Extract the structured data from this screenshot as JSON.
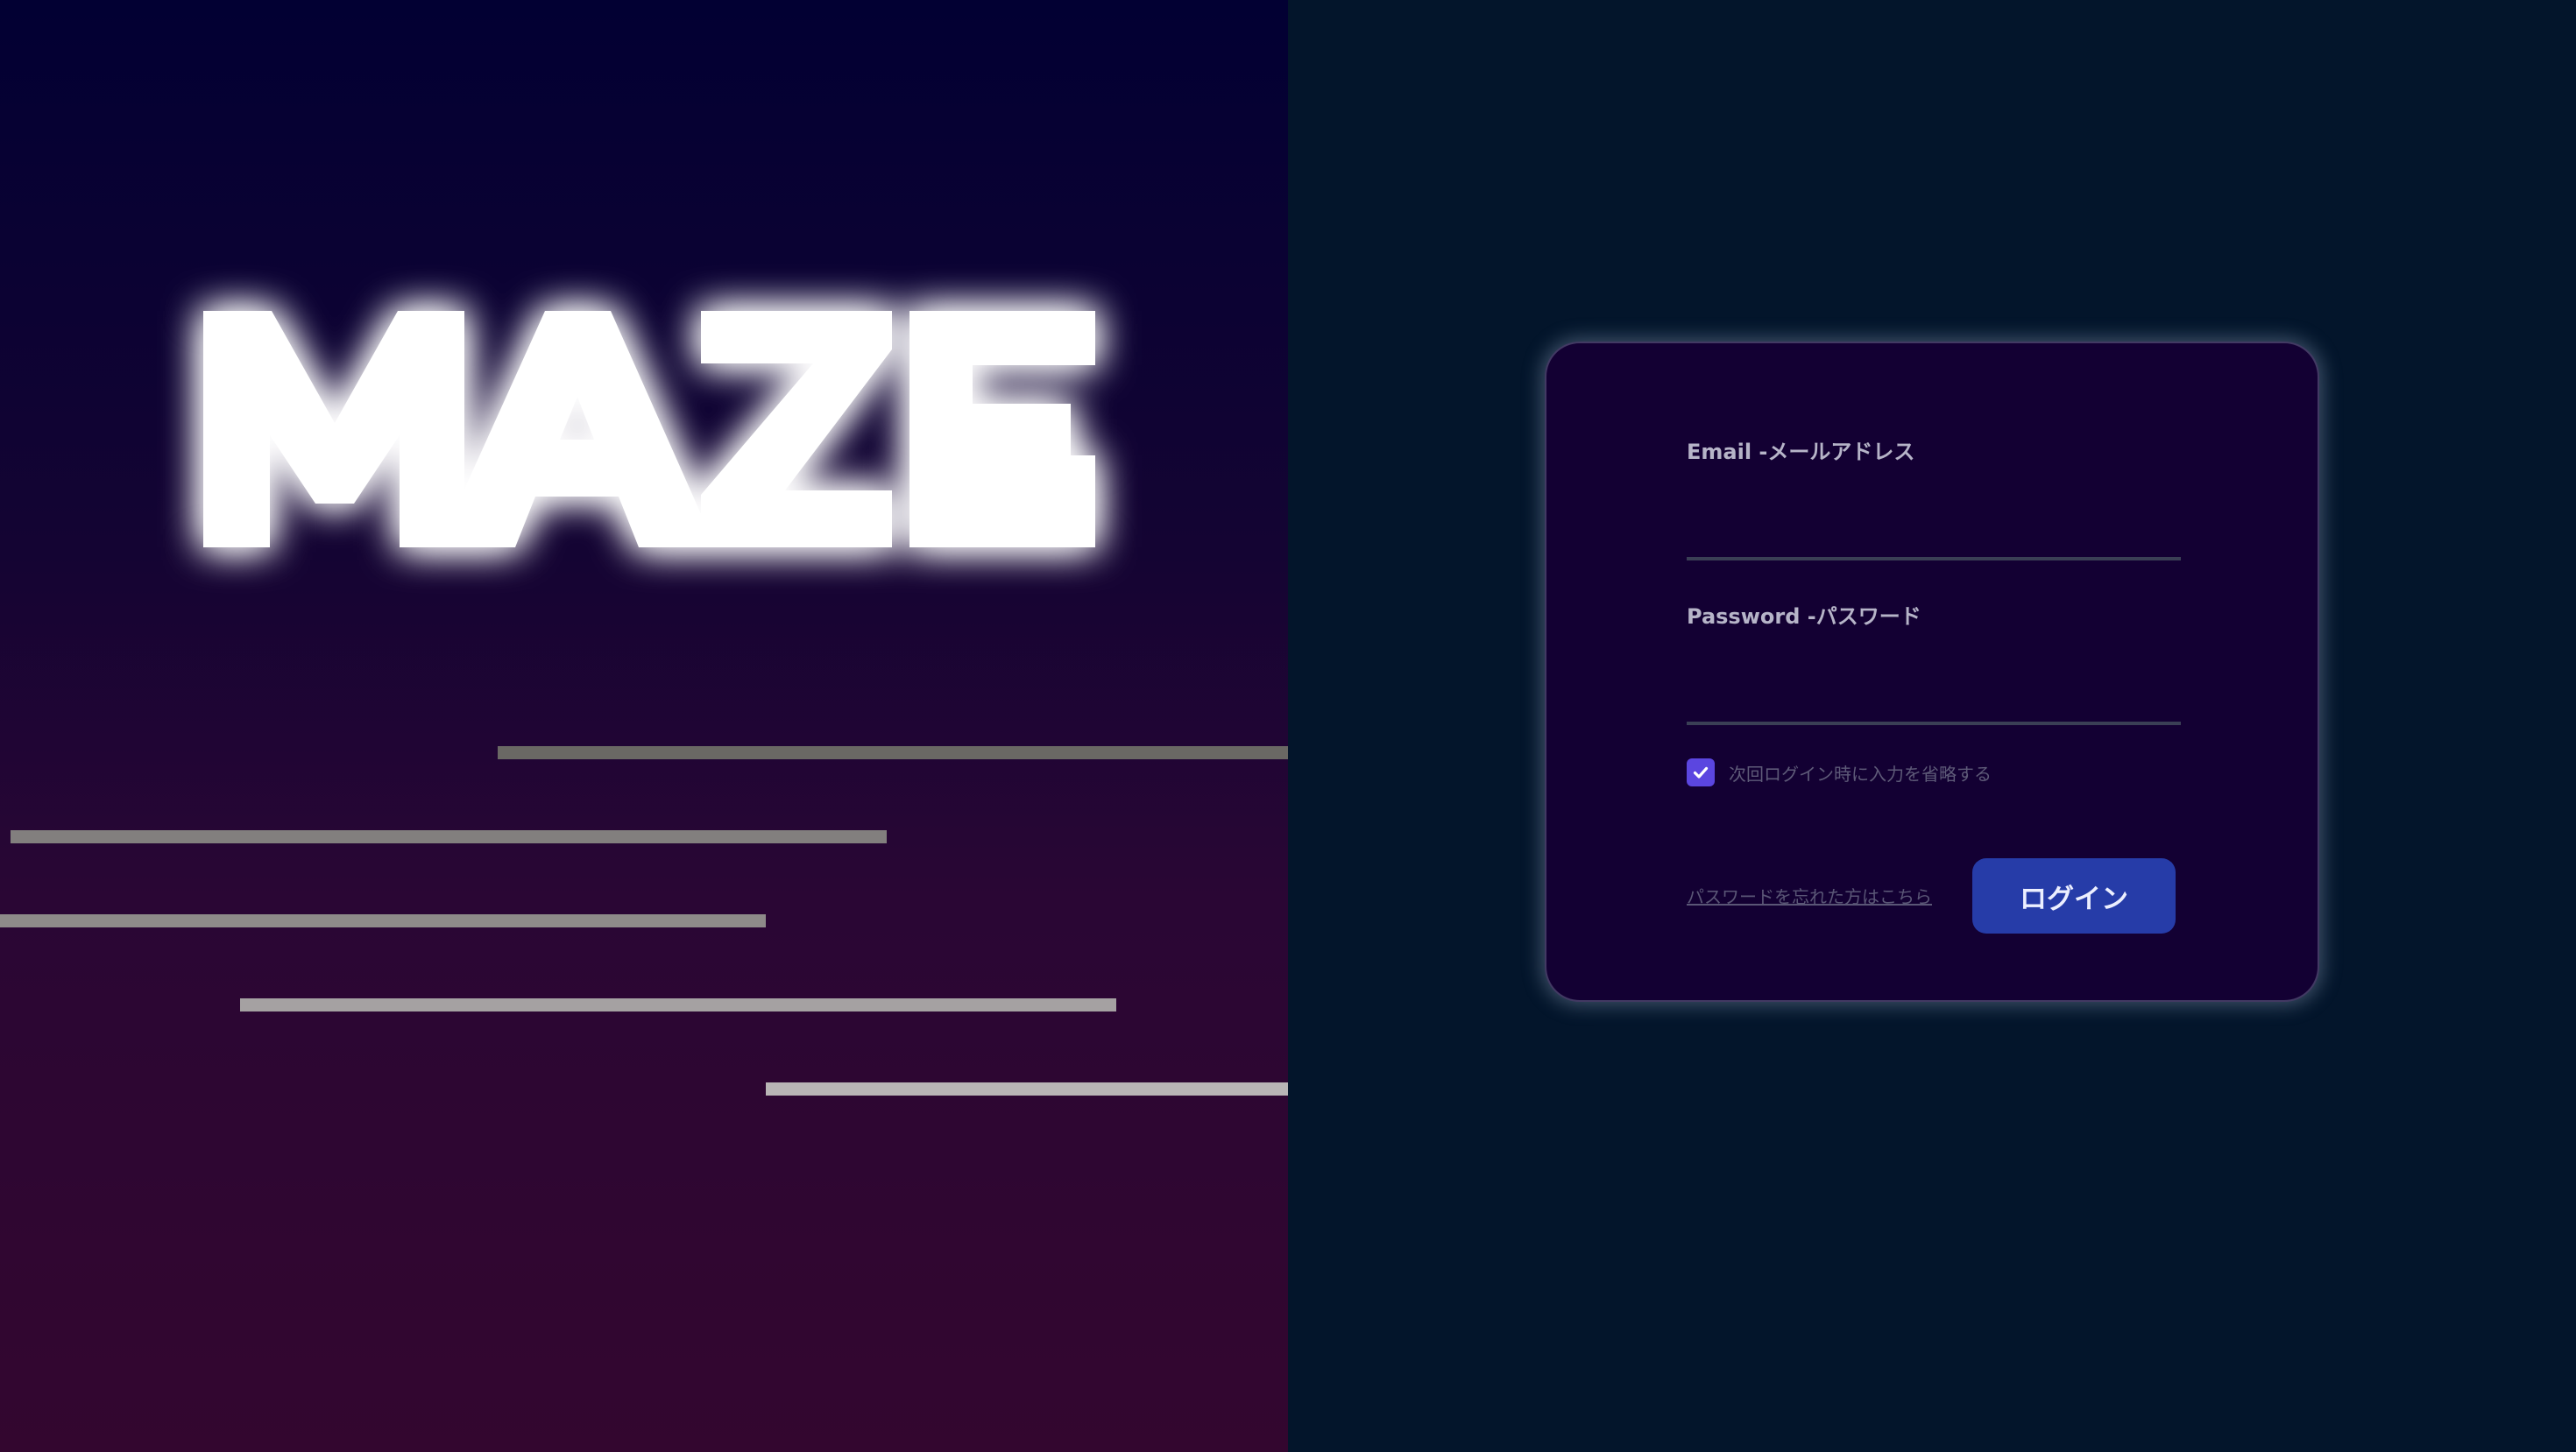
{
  "brand": {
    "logo_text": "MAZE"
  },
  "form": {
    "email_label": "Email -メールアドレス",
    "email_value": "",
    "password_label": "Password -パスワード",
    "password_value": "",
    "remember_label": "次回ログイン時に入力を省略する",
    "remember_checked": true,
    "forgot_link": "パスワードを忘れた方はこちら",
    "login_button": "ログイン"
  },
  "colors": {
    "left_bg_top": "#020033",
    "left_bg_bottom": "#33062f",
    "right_bg": "#03152b",
    "card_bg": "#130033",
    "accent_checkbox": "#5b46e0",
    "button_bg": "#263ca8"
  },
  "icons": {
    "checkbox": "check-icon"
  }
}
